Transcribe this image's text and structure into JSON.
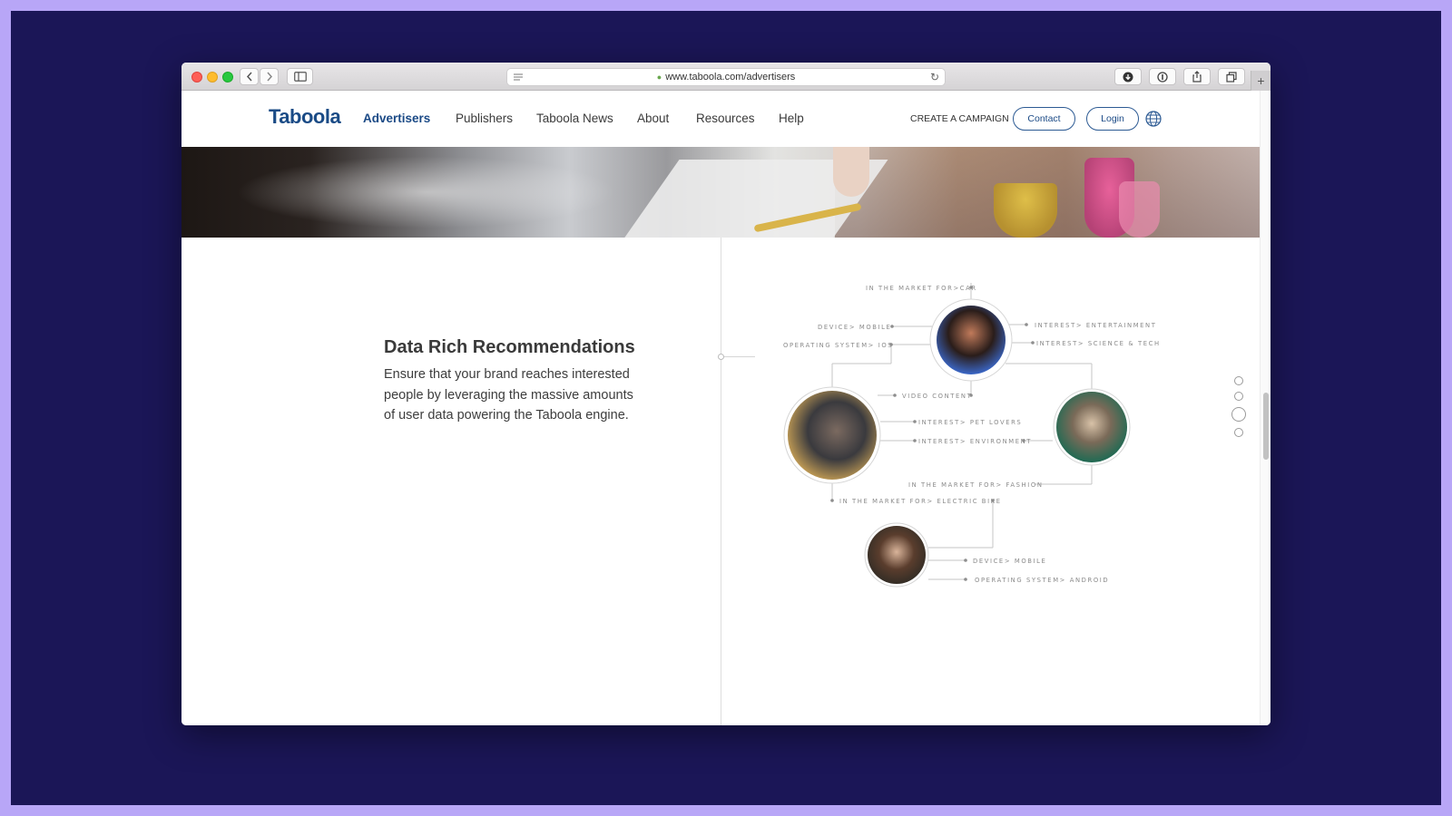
{
  "browser": {
    "url": "www.taboola.com/advertisers",
    "icons": [
      "back-icon",
      "forward-icon",
      "sidebar-icon",
      "reader-icon",
      "lock-icon",
      "reload-icon",
      "download-icon",
      "password-icon",
      "share-icon",
      "tabs-icon",
      "new-tab-icon"
    ]
  },
  "nav": {
    "logo": "Taboola",
    "items": [
      "Advertisers",
      "Publishers",
      "Taboola News",
      "About",
      "Resources",
      "Help"
    ],
    "active": "Advertisers",
    "create_campaign": "CREATE A CAMPAIGN",
    "contact": "Contact",
    "login": "Login"
  },
  "section": {
    "heading": "Data Rich Recommendations",
    "body": "Ensure that your brand reaches interested people by leveraging the massive amounts of user data powering the Taboola engine."
  },
  "diagram": {
    "labels": {
      "market_car": "IN THE MARKET FOR>CAR",
      "device_mobile_1": "DEVICE> MOBILE",
      "os_ios": "OPERATING SYSTEM> IOS",
      "interest_entertainment": "INTEREST> ENTERTAINMENT",
      "interest_science": "INTEREST> SCIENCE & TECH",
      "video_content": "VIDEO CONTENT",
      "interest_pets": "INTEREST> PET LOVERS",
      "interest_environment": "INTEREST> ENVIRONMENT",
      "market_fashion": "IN THE MARKET FOR> FASHION",
      "market_bike": "IN THE MARKET FOR> ELECTRIC BIKE",
      "device_mobile_2": "DEVICE> MOBILE",
      "os_android": "OPERATING SYSTEM> ANDROID"
    }
  },
  "colors": {
    "brand": "#1b4a86",
    "frame": "#b8a6f7",
    "backdrop": "#1b1657"
  }
}
